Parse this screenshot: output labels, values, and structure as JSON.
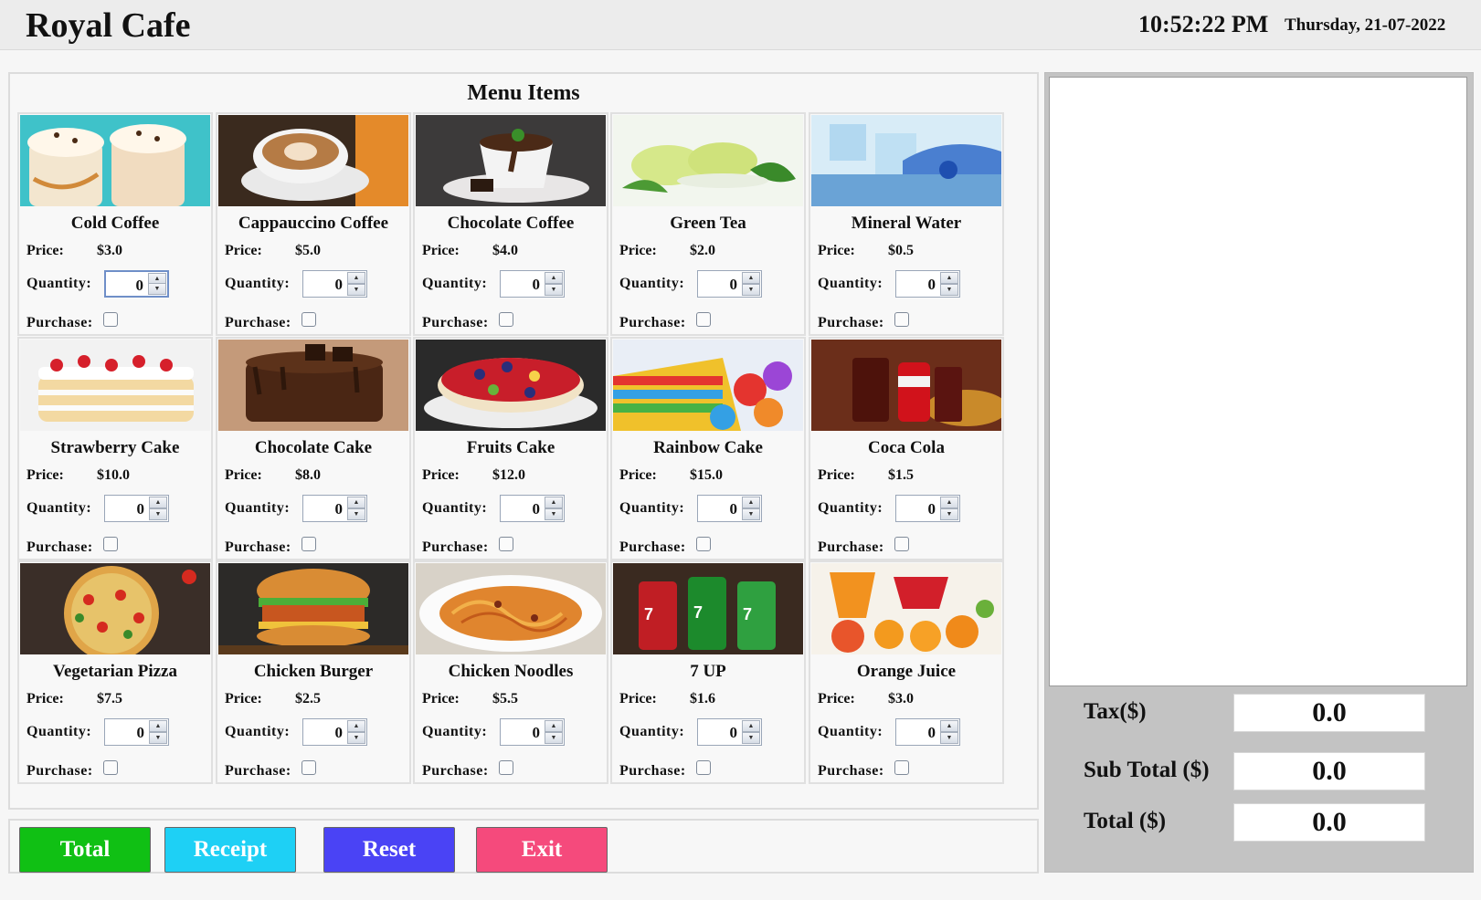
{
  "header": {
    "title": "Royal Cafe",
    "time": "10:52:22 PM",
    "date": "Thursday, 21-07-2022"
  },
  "menu": {
    "heading": "Menu Items",
    "price_label": "Price:",
    "quantity_label": "Quantity:",
    "purchase_label": "Purchase:",
    "items": [
      {
        "name": "Cold Coffee",
        "price": "$3.0",
        "quantity": "0"
      },
      {
        "name": "Cappauccino Coffee",
        "price": "$5.0",
        "quantity": "0"
      },
      {
        "name": "Chocolate Coffee",
        "price": "$4.0",
        "quantity": "0"
      },
      {
        "name": "Green Tea",
        "price": "$2.0",
        "quantity": "0"
      },
      {
        "name": "Mineral Water",
        "price": "$0.5",
        "quantity": "0"
      },
      {
        "name": "Strawberry Cake",
        "price": "$10.0",
        "quantity": "0"
      },
      {
        "name": "Chocolate Cake",
        "price": "$8.0",
        "quantity": "0"
      },
      {
        "name": "Fruits Cake",
        "price": "$12.0",
        "quantity": "0"
      },
      {
        "name": "Rainbow Cake",
        "price": "$15.0",
        "quantity": "0"
      },
      {
        "name": "Coca Cola",
        "price": "$1.5",
        "quantity": "0"
      },
      {
        "name": "Vegetarian Pizza",
        "price": "$7.5",
        "quantity": "0"
      },
      {
        "name": "Chicken Burger",
        "price": "$2.5",
        "quantity": "0"
      },
      {
        "name": "Chicken Noodles",
        "price": "$5.5",
        "quantity": "0"
      },
      {
        "name": "7 UP",
        "price": "$1.6",
        "quantity": "0"
      },
      {
        "name": "Orange Juice",
        "price": "$3.0",
        "quantity": "0"
      }
    ]
  },
  "buttons": {
    "total": "Total",
    "receipt": "Receipt",
    "reset": "Reset",
    "exit": "Exit"
  },
  "button_colors": {
    "total": "#10c014",
    "receipt": "#1ed0f5",
    "reset": "#4a43f5",
    "exit": "#f54a7c"
  },
  "summary": {
    "tax_label": "Tax($)",
    "tax_value": "0.0",
    "subtotal_label": "Sub Total ($)",
    "subtotal_value": "0.0",
    "total_label": "Total ($)",
    "total_value": "0.0"
  }
}
